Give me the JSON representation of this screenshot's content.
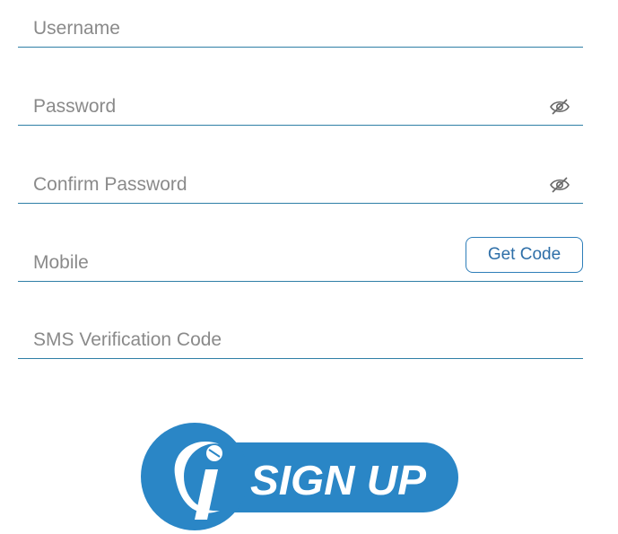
{
  "form": {
    "username": {
      "placeholder": "Username",
      "value": ""
    },
    "password": {
      "placeholder": "Password",
      "value": ""
    },
    "confirm_password": {
      "placeholder": "Confirm Password",
      "value": ""
    },
    "mobile": {
      "placeholder": "Mobile",
      "value": ""
    },
    "sms_code": {
      "placeholder": "SMS Verification Code",
      "value": ""
    },
    "get_code_label": "Get Code",
    "eye_icon": "eye-slash-icon"
  },
  "signup": {
    "label": "SIGN UP",
    "logo_letter": "i",
    "color": "#2a86c6"
  },
  "colors": {
    "underline": "#2f7fa6",
    "placeholder": "#8a8a8a",
    "accent": "#2e7eb9"
  }
}
